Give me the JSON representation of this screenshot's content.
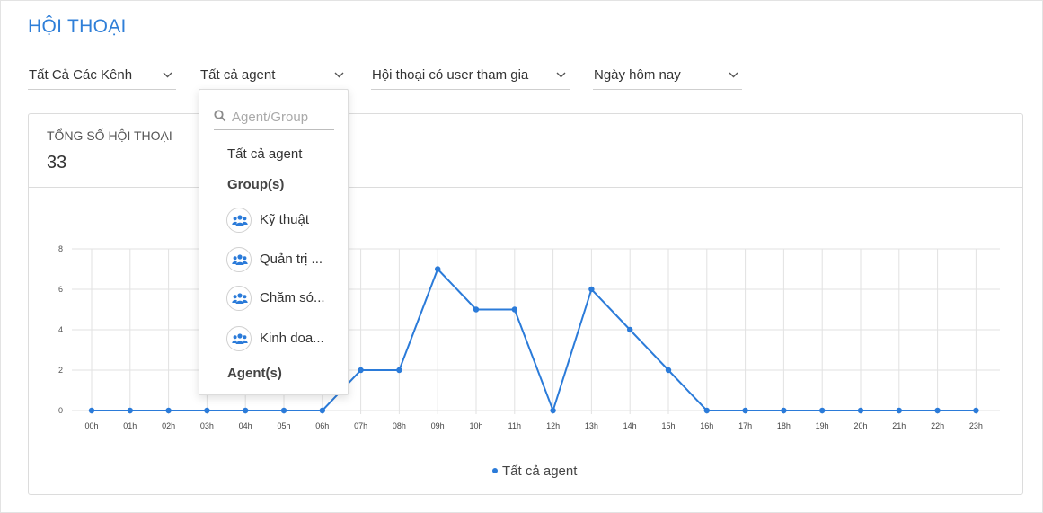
{
  "page": {
    "title": "HỘI THOẠI"
  },
  "filters": {
    "channel": "Tất Cả Các Kênh",
    "agent": "Tất cả agent",
    "conversation_type": "Hội thoại có user tham gia",
    "date_range": "Ngày hôm nay"
  },
  "summary": {
    "label": "TỔNG SỐ HỘI THOẠI",
    "value": "33"
  },
  "agent_dropdown": {
    "search_placeholder": "Agent/Group",
    "all_option": "Tất cả agent",
    "groups_heading": "Group(s)",
    "groups": [
      {
        "label": "Kỹ thuật",
        "icon": "group-icon"
      },
      {
        "label": "Quản trị ...",
        "icon": "group-icon"
      },
      {
        "label": "Chăm só...",
        "icon": "group-icon"
      },
      {
        "label": "Kinh doa...",
        "icon": "group-icon"
      }
    ],
    "agents_heading": "Agent(s)"
  },
  "chart_data": {
    "type": "line",
    "categories": [
      "00h",
      "01h",
      "02h",
      "03h",
      "04h",
      "05h",
      "06h",
      "07h",
      "08h",
      "09h",
      "10h",
      "11h",
      "12h",
      "13h",
      "14h",
      "15h",
      "16h",
      "17h",
      "18h",
      "19h",
      "20h",
      "21h",
      "22h",
      "23h"
    ],
    "y_ticks": [
      "0",
      "2",
      "4",
      "6",
      "8"
    ],
    "ylim": [
      0,
      8
    ],
    "grid": true,
    "legend_position": "bottom",
    "series": [
      {
        "name": "Tất cả agent",
        "color": "#2b7bd9",
        "values": [
          0,
          0,
          0,
          0,
          0,
          0,
          0,
          2,
          2,
          7,
          5,
          5,
          0,
          6,
          4,
          2,
          0,
          0,
          0,
          0,
          0,
          0,
          0,
          0
        ]
      }
    ]
  }
}
